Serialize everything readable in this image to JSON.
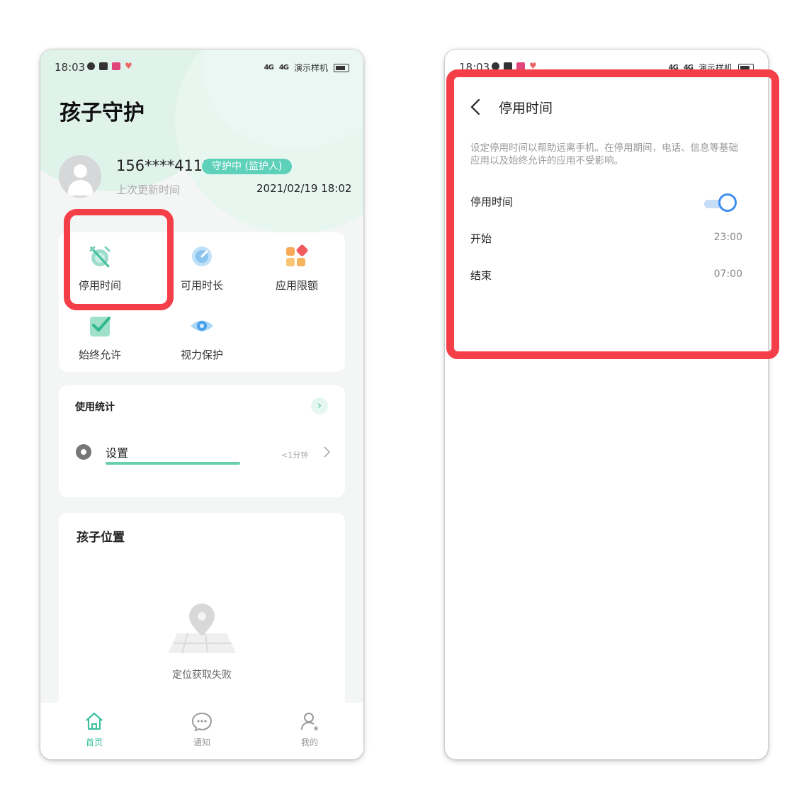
{
  "status_bar": {
    "time": "18:03",
    "signal_1": "4G",
    "signal_2": "4G",
    "carrier": "演示样机"
  },
  "left_screen": {
    "page_title": "孩子守护",
    "profile": {
      "phone": "156****4111",
      "badge": "守护中 (监护人)",
      "last_update_label": "上次更新时间",
      "last_update_value": "2021/02/19 18:02"
    },
    "functions": [
      {
        "label": "停用时间",
        "icon": "alarm-off-icon"
      },
      {
        "label": "可用时长",
        "icon": "timer-icon"
      },
      {
        "label": "应用限额",
        "icon": "app-limit-icon"
      },
      {
        "label": "始终允许",
        "icon": "check-icon"
      },
      {
        "label": "视力保护",
        "icon": "eye-icon"
      }
    ],
    "usage": {
      "title": "使用统计",
      "items": [
        {
          "name": "设置",
          "duration": "<1分钟",
          "icon": "gear-icon"
        }
      ]
    },
    "location": {
      "title": "孩子位置",
      "message": "定位获取失败"
    },
    "tabs": [
      {
        "label": "首页",
        "icon": "home-icon",
        "active": true
      },
      {
        "label": "通知",
        "icon": "chat-icon",
        "active": false
      },
      {
        "label": "我的",
        "icon": "user-icon",
        "active": false
      }
    ]
  },
  "right_screen": {
    "title": "停用时间",
    "description": "设定停用时间以帮助远离手机。在停用期间，电话、信息等基础应用以及始终允许的应用不受影响。",
    "toggle": {
      "label": "停用时间",
      "on": true
    },
    "start": {
      "label": "开始",
      "value": "23:00"
    },
    "end": {
      "label": "结束",
      "value": "07:00"
    }
  },
  "colors": {
    "accent": "#3dc09f",
    "badge": "#5ed1ba",
    "highlight": "#f43f48",
    "toggle": "#3d8ef2"
  }
}
